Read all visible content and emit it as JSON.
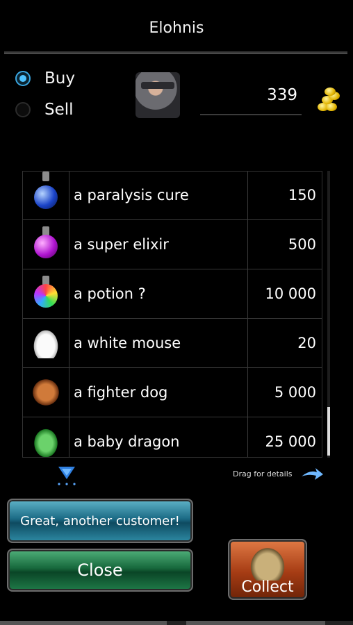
{
  "title": "Elohnis",
  "mode": {
    "options": [
      {
        "label": "Buy",
        "selected": true
      },
      {
        "label": "Sell",
        "selected": false
      }
    ]
  },
  "gold": {
    "value": "339",
    "icon": "gold-coins-icon"
  },
  "portrait_icon": "knight-portrait-icon",
  "items": [
    {
      "name": "a paralysis cure",
      "price": "150",
      "icon": "blue-potion-icon"
    },
    {
      "name": "a super elixir",
      "price": "500",
      "icon": "purple-potion-icon"
    },
    {
      "name": "a potion ?",
      "price": "10 000",
      "icon": "rainbow-potion-icon"
    },
    {
      "name": "a white mouse",
      "price": "20",
      "icon": "white-mouse-icon"
    },
    {
      "name": "a fighter dog",
      "price": "5 000",
      "icon": "fighter-dog-icon"
    },
    {
      "name": "a baby dragon",
      "price": "25 000",
      "icon": "baby-dragon-icon"
    }
  ],
  "hints": {
    "drag_for_details": "Drag for details"
  },
  "buttons": {
    "greet": "Great, another customer!",
    "close": "Close",
    "collect": "Collect"
  },
  "colors": {
    "accent_blue": "#4fc3ff",
    "greet_button": "#1b6b85",
    "close_button": "#17683c",
    "collect_button": "#a63c14"
  }
}
